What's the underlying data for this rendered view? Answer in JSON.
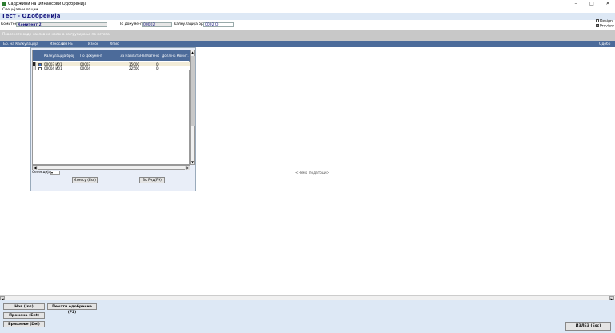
{
  "window": {
    "title": "Садржини на Финансови Одобренија",
    "minimize": "–",
    "maximize": "□",
    "close": "✕"
  },
  "menu": {
    "special_options": "Специјални опции"
  },
  "page": {
    "title": "Тест - Одобренија"
  },
  "checks": {
    "design": "Design",
    "preview": "Preview",
    "design_checked": false,
    "preview_checked": true
  },
  "filters": {
    "komitent_label": "Комитент",
    "komitent_value": "Комитент 2",
    "po_dokument_label": "По документ",
    "po_dokument_value": "00002",
    "kalkulacija_label": "Калкулација број",
    "kalkulacija_value": "0002  О"
  },
  "group_hint": "Повлечете овде наслов на колона за групирање по истата",
  "main_grid": {
    "headers": [
      "Бр. на Калкулација",
      "Износ без",
      "За",
      "НЕТ",
      "Износ",
      "Опис"
    ],
    "right_header": "Одобр",
    "empty_text": "<Нема податоци>"
  },
  "popup": {
    "headers": [
      "Калкулација број",
      "По Документ",
      "За Наплата",
      "Наплатено",
      "Допл на Комит."
    ],
    "rows": [
      {
        "kalk": "00003  И01",
        "doc": "00003",
        "za_naplata": "15000",
        "naplateno": "0",
        "selected": true
      },
      {
        "kalk": "00004  И01",
        "doc": "00004",
        "za_naplata": "22500",
        "naplateno": "0",
        "selected": false
      }
    ],
    "selection_label": "Селекција",
    "selection_value": "▾",
    "cancel_button": "Изнесу (Esc)",
    "to_row_button": "Во Ред(F9)"
  },
  "bottom": {
    "new_button": "Нов (Ins)",
    "print_button": "Печати одобрение (F2)",
    "edit_button": "Промена (Ent)",
    "delete_button": "Бришење (Del)",
    "exit_button": "ИЗЛЕЗ (Esc)"
  }
}
